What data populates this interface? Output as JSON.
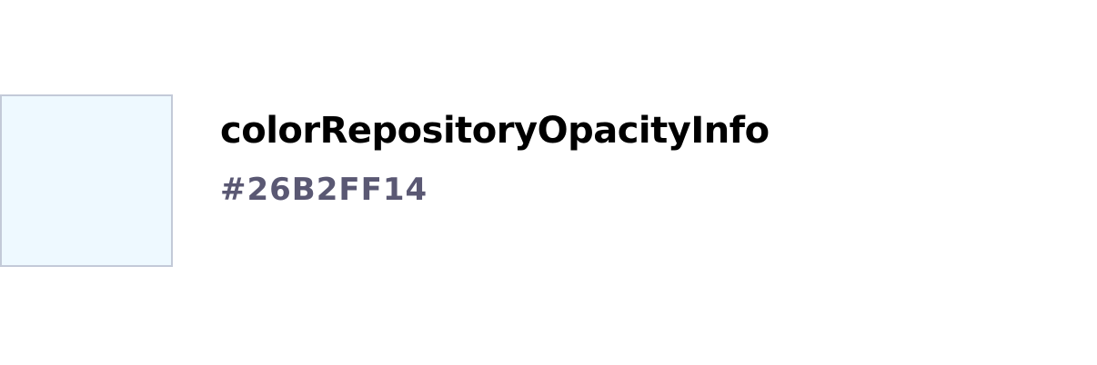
{
  "token": {
    "name": "colorRepositoryOpacityInfo",
    "value": "#26B2FF14"
  },
  "colors": {
    "swatch": "#26B2FF14",
    "swatch_border": "#c3cad8",
    "name_text": "#000000",
    "value_text": "#5a5873"
  }
}
